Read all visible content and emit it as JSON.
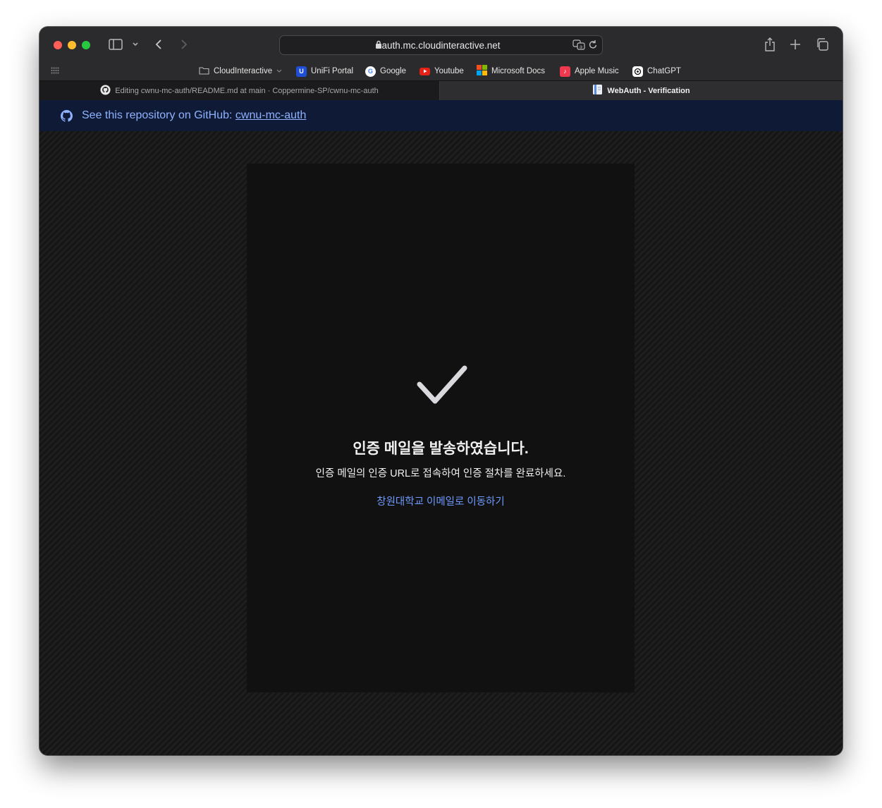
{
  "browser": {
    "url": "auth.mc.cloudinteractive.net",
    "favorites": [
      {
        "label": "CloudInteractive",
        "icon": "folder-icon"
      },
      {
        "label": "UniFi Portal",
        "icon": "unifi-icon"
      },
      {
        "label": "Google",
        "icon": "google-icon"
      },
      {
        "label": "Youtube",
        "icon": "youtube-icon"
      },
      {
        "label": "Microsoft Docs",
        "icon": "microsoft-icon"
      },
      {
        "label": "Apple Music",
        "icon": "apple-music-icon"
      },
      {
        "label": "ChatGPT",
        "icon": "chatgpt-icon"
      }
    ],
    "tabs": [
      {
        "label": "Editing cwnu-mc-auth/README.md at main · Coppermine-SP/cwnu-mc-auth",
        "active": false
      },
      {
        "label": "WebAuth - Verification",
        "active": true
      }
    ]
  },
  "banner": {
    "prefix": "See this repository on GitHub: ",
    "link": "cwnu-mc-auth"
  },
  "card": {
    "title": "인증 메일을 발송하였습니다.",
    "description": "인증 메일의 인증 URL로 접속하여 인증 절차를 완료하세요.",
    "link": "창원대학교 이메일로 이동하기"
  },
  "colors": {
    "banner_bg": "#0f1a36",
    "link": "#6e9bff",
    "card_bg": "#111111"
  }
}
